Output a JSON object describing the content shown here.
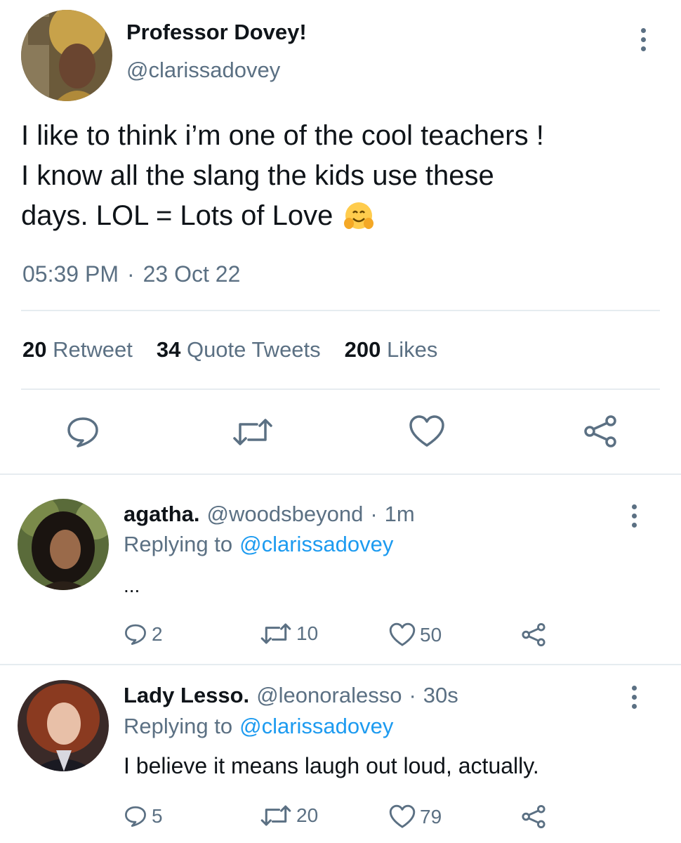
{
  "tweet": {
    "display_name": "Professor Dovey!",
    "handle": "@clarissadovey",
    "text_line1": "I like to think i’m one of the cool teachers !",
    "text_line2": "I know all the slang the kids use these",
    "text_line3": "days. LOL = Lots of Love",
    "emoji": "🤗",
    "time": "05:39 PM",
    "separator": "·",
    "date": "23 Oct 22",
    "retweet_count": "20",
    "retweet_label": "Retweet",
    "quote_count": "34",
    "quote_label": "Quote Tweets",
    "like_count": "200",
    "like_label": "Likes",
    "icons": [
      "reply-icon",
      "retweet-icon",
      "like-icon",
      "share-icon",
      "more-icon"
    ]
  },
  "replies": [
    {
      "display_name": "agatha.",
      "handle": "@woodsbeyond",
      "separator": "·",
      "age": "1m",
      "replying_label": "Replying to",
      "replying_to": "@clarissadovey",
      "text": "...",
      "reply_count": "2",
      "retweet_count": "10",
      "like_count": "50"
    },
    {
      "display_name": "Lady Lesso.",
      "handle": "@leonoralesso",
      "separator": "·",
      "age": "30s",
      "replying_label": "Replying to",
      "replying_to": "@clarissadovey",
      "text": "I believe it means laugh out loud, actually.",
      "reply_count": "5",
      "retweet_count": "20",
      "like_count": "79"
    }
  ],
  "colors": {
    "text": "#0f1419",
    "muted": "#5b7083",
    "link": "#1d9bf0",
    "divider": "#e6ecf0"
  }
}
